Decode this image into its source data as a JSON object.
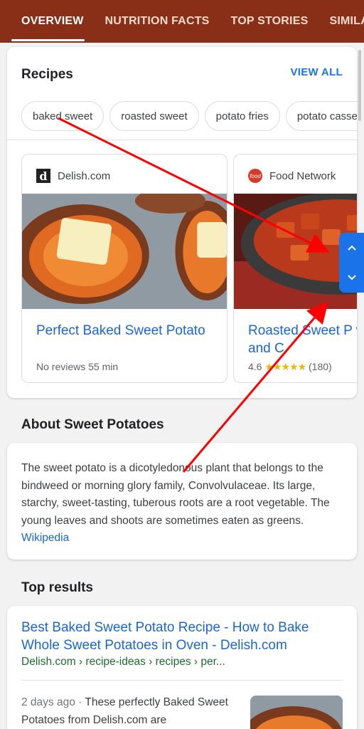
{
  "tabs": [
    {
      "label": "OVERVIEW",
      "active": true
    },
    {
      "label": "NUTRITION FACTS",
      "active": false
    },
    {
      "label": "TOP STORIES",
      "active": false
    },
    {
      "label": "SIMILAR",
      "active": false
    }
  ],
  "recipes": {
    "title": "Recipes",
    "view_all": "VIEW ALL",
    "chips": [
      "baked sweet",
      "roasted sweet",
      "potato fries",
      "potato casser"
    ],
    "cards": [
      {
        "source": "Delish.com",
        "logo": "d",
        "title": "Perfect Baked Sweet Potato",
        "meta": "No reviews 55 min"
      },
      {
        "source": "Food Network",
        "logo": "food",
        "title": "Roasted Sweet P with Honey and C",
        "rating": "4.6",
        "stars": "★★★★★",
        "reviews": "(180)"
      }
    ]
  },
  "about": {
    "title": "About Sweet Potatoes",
    "text": "The sweet potato is a dicotyledonous plant that belongs to the bindweed or morning glory family, Convolvulaceae. Its large, starchy, sweet-tasting, tuberous roots are a root vegetable. The young leaves and shoots are sometimes eaten as greens.",
    "link": "Wikipedia"
  },
  "top_results": {
    "title": "Top results",
    "items": [
      {
        "link": "Best Baked Sweet Potato Recipe - How to Bake Whole Sweet Potatoes in Oven - Delish.com",
        "url": "Delish.com › recipe-ideas › recipes › per...",
        "date": "2 days ago",
        "snippet": "These perfectly Baked Sweet Potatoes from Delish.com are"
      }
    ]
  },
  "icons": {
    "scroll_up": "chevron-up-icon",
    "scroll_down": "chevron-down-icon"
  },
  "colors": {
    "tabbar": "#8a2f17",
    "link": "#1a66d2",
    "accent": "#1a73e8",
    "annotation": "#ff0000",
    "url_green": "#1e6b2f",
    "star": "#f4b400"
  }
}
